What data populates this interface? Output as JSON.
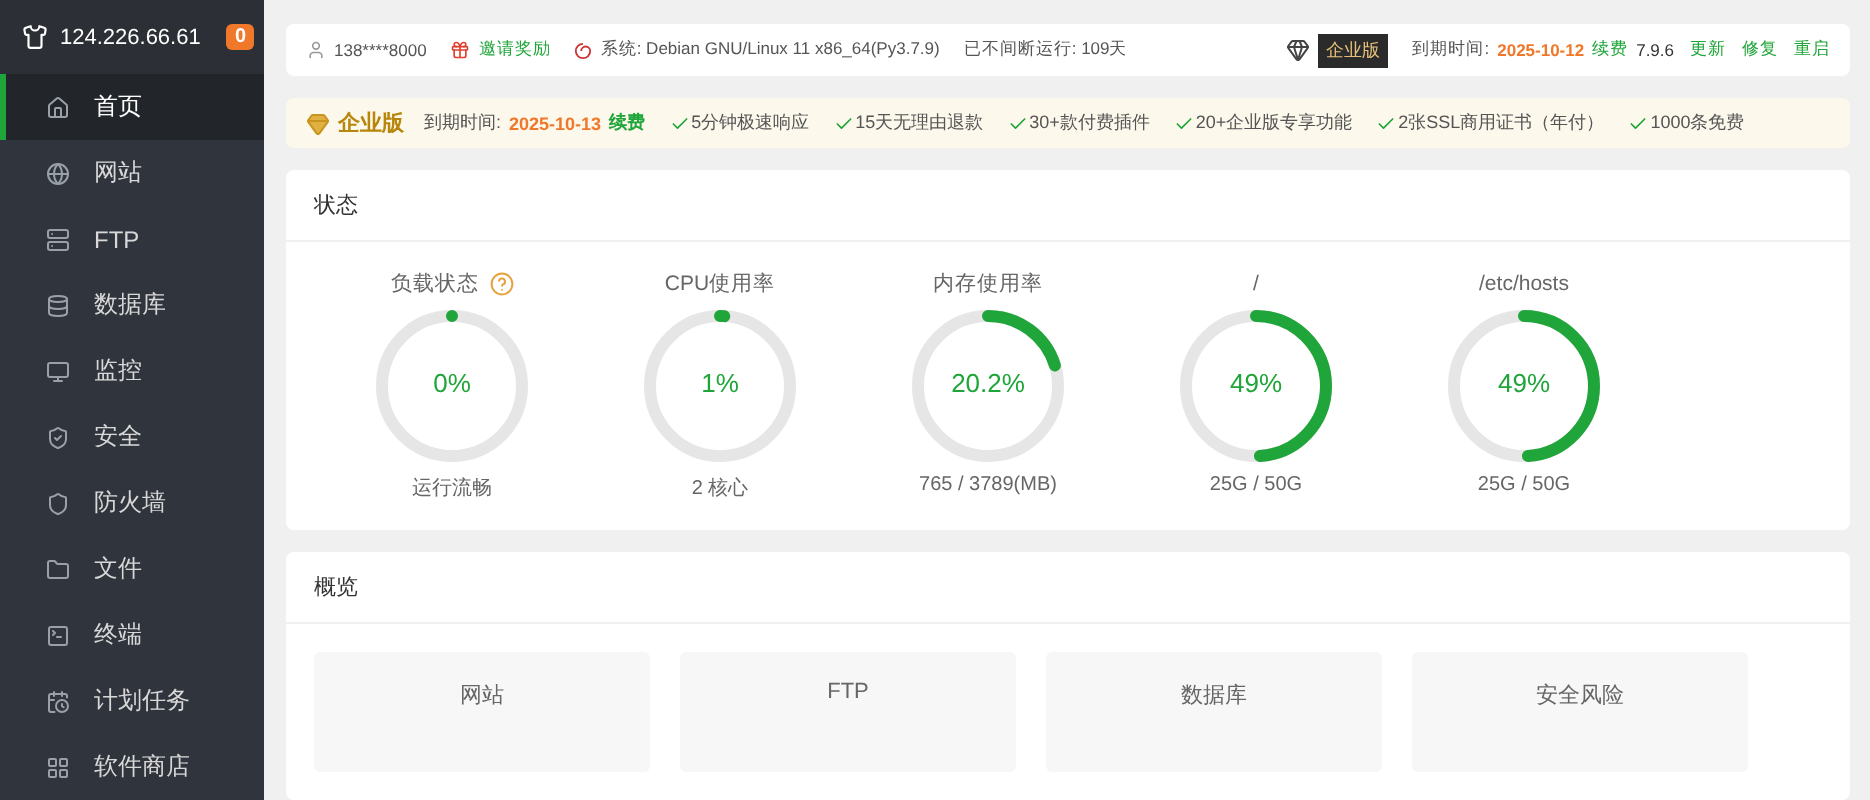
{
  "server": {
    "ip": "124.226.66.61",
    "badge": "0"
  },
  "sidebar": {
    "items": [
      {
        "label": "首页",
        "selected": true
      },
      {
        "label": "网站",
        "selected": false
      },
      {
        "label": "FTP",
        "selected": false
      },
      {
        "label": "数据库",
        "selected": false
      },
      {
        "label": "监控",
        "selected": false
      },
      {
        "label": "安全",
        "selected": false
      },
      {
        "label": "防火墙",
        "selected": false
      },
      {
        "label": "文件",
        "selected": false
      },
      {
        "label": "终端",
        "selected": false
      },
      {
        "label": "计划任务",
        "selected": false
      },
      {
        "label": "软件商店",
        "selected": false
      }
    ]
  },
  "topbar": {
    "user": "138****8000",
    "invite": "邀请奖励",
    "system": "系统:  Debian GNU/Linux 11 x86_64(Py3.7.9)",
    "uptime": "已不间断运行: 109天",
    "edition": "企业版",
    "expire_label": "到期时间:",
    "expire_date": "2025-10-12",
    "renew": "续费",
    "version": "7.9.6",
    "links": [
      "更新",
      "修复",
      "重启"
    ]
  },
  "banner": {
    "edition": "企业版",
    "expire_label": "到期时间:",
    "expire_date": "2025-10-13",
    "renew": "续费",
    "features": [
      "5分钟极速响应",
      "15天无理由退款",
      "30+款付费插件",
      "20+企业版专享功能",
      "2张SSL商用证书（年付）",
      "1000条免费"
    ]
  },
  "status": {
    "title": "状态",
    "gauges": [
      {
        "label": "负载状态",
        "help": true,
        "value": "0%",
        "level": 0,
        "sub": "运行流畅"
      },
      {
        "label": "CPU使用率",
        "help": false,
        "value": "1%",
        "level": 0.01,
        "sub": "2 核心"
      },
      {
        "label": "内存使用率",
        "help": false,
        "value": "20.2%",
        "level": 0.202,
        "sub": "765 / 3789(MB)"
      },
      {
        "label": "/",
        "help": false,
        "value": "49%",
        "level": 0.49,
        "sub": "25G / 50G"
      },
      {
        "label": "/etc/hosts",
        "help": false,
        "value": "49%",
        "level": 0.49,
        "sub": "25G / 50G"
      }
    ]
  },
  "overview": {
    "title": "概览",
    "tiles": [
      "网站",
      "FTP",
      "数据库",
      "安全风险"
    ]
  }
}
